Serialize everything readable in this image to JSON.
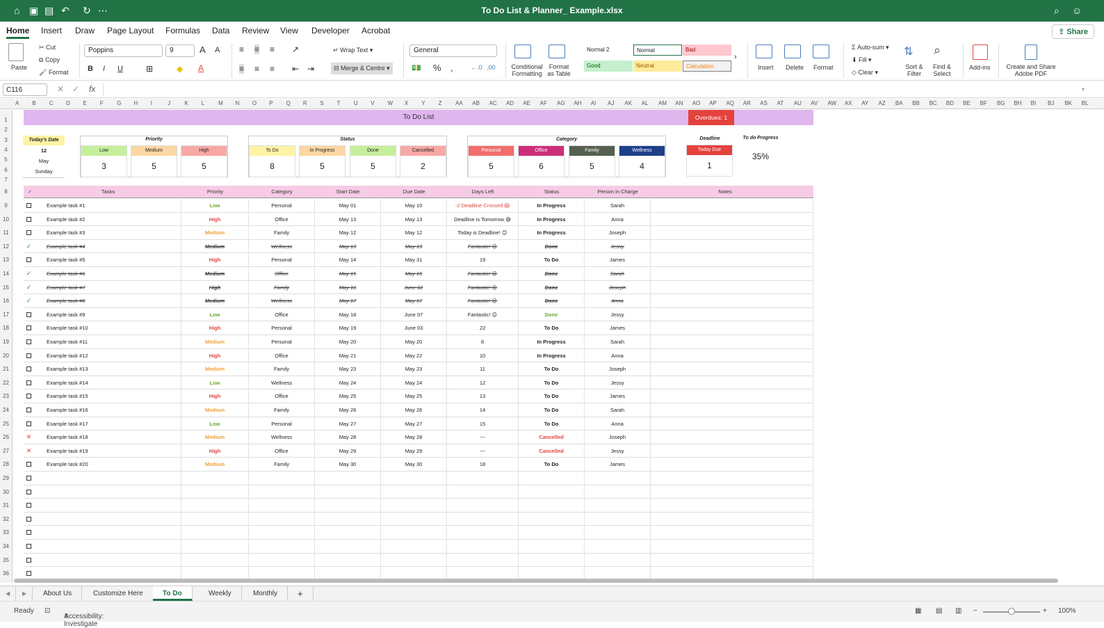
{
  "titlebar": {
    "title": "To Do List & Planner_ Example.xlsx"
  },
  "menu": {
    "tabs": [
      "Home",
      "Insert",
      "Draw",
      "Page Layout",
      "Formulas",
      "Data",
      "Review",
      "View",
      "Developer",
      "Acrobat"
    ],
    "share": "Share"
  },
  "ribbon": {
    "paste": "Paste",
    "cut": "Cut",
    "copy": "Copy",
    "format": "Format",
    "font": "Poppins",
    "font_size": "9",
    "wrap_text": "Wrap Text",
    "merge": "Merge & Centre",
    "number_format": "General",
    "conditional": "Conditional Formatting",
    "format_table": "Format as Table",
    "styles": {
      "normal2": "Normal 2",
      "normal": "Normal",
      "bad": "Bad",
      "good": "Good",
      "neutral": "Neutral",
      "calculation": "Calculation"
    },
    "insert": "Insert",
    "delete": "Delete",
    "format_cells": "Format",
    "autosum": "Auto-sum",
    "fill": "Fill",
    "clear": "Clear",
    "sort": "Sort & Filter",
    "find": "Find & Select",
    "addins": "Add-ins",
    "adobe": "Create and Share Adobe PDF"
  },
  "formula": {
    "namebox": "C116",
    "fx": "fx"
  },
  "columns": [
    "A",
    "B",
    "C",
    "D",
    "E",
    "F",
    "G",
    "H",
    "I",
    "J",
    "K",
    "L",
    "M",
    "N",
    "O",
    "P",
    "Q",
    "R",
    "S",
    "T",
    "U",
    "V",
    "W",
    "X",
    "Y",
    "Z",
    "AA",
    "AB",
    "AC",
    "AD",
    "AE",
    "AF",
    "AG",
    "AH",
    "AI",
    "AJ",
    "AK",
    "AL",
    "AM",
    "AN",
    "AO",
    "AP",
    "AQ",
    "AR",
    "AS",
    "AT",
    "AU",
    "AV",
    "AW",
    "AX",
    "AY",
    "AZ",
    "BA",
    "BB",
    "BC",
    "BD",
    "BE",
    "BF",
    "BG",
    "BH",
    "BI",
    "BJ",
    "BK",
    "BL"
  ],
  "sheet": {
    "title": "To Do List",
    "overdue": "Overdues: 1",
    "today": {
      "label": "Today's Date",
      "day": "12",
      "month": "May",
      "weekday": "Sunday"
    },
    "priority": {
      "title": "Priority",
      "items": [
        {
          "label": "Low",
          "value": "3"
        },
        {
          "label": "Medium",
          "value": "5"
        },
        {
          "label": "High",
          "value": "5"
        }
      ]
    },
    "status": {
      "title": "Status",
      "items": [
        {
          "label": "To Do",
          "value": "8"
        },
        {
          "label": "In Progress",
          "value": "5"
        },
        {
          "label": "Done",
          "value": "5"
        },
        {
          "label": "Cancelled",
          "value": "2"
        }
      ]
    },
    "category": {
      "title": "Category",
      "items": [
        {
          "label": "Personal",
          "value": "5"
        },
        {
          "label": "Office",
          "value": "6"
        },
        {
          "label": "Family",
          "value": "5"
        },
        {
          "label": "Wellness",
          "value": "4"
        }
      ]
    },
    "deadline": {
      "title": "Deadline",
      "label": "Today Due",
      "value": "1"
    },
    "progress": {
      "label": "To do Progress",
      "value": "35%"
    },
    "headers": {
      "check": "✓",
      "tasks": "Tasks",
      "priority": "Priority",
      "category": "Category",
      "start": "Start Date",
      "due": "Due Date",
      "days": "Days Left",
      "status": "Status",
      "person": "Person in Charge",
      "notes": "Notes"
    },
    "rows": [
      {
        "mark": "box",
        "task": "Example task #1",
        "priority": "Low",
        "category": "Personal",
        "start": "May 01",
        "due": "May 10",
        "days": "-2 Deadline Crossed 😱",
        "status": "In Progress",
        "person": "Sarah"
      },
      {
        "mark": "box",
        "task": "Example task #2",
        "priority": "High",
        "category": "Office",
        "start": "May 13",
        "due": "May 13",
        "days": "Deadline is Tomorrow 😅",
        "status": "In Progress",
        "person": "Anna"
      },
      {
        "mark": "box",
        "task": "Example task #3",
        "priority": "Medium",
        "category": "Family",
        "start": "May 12",
        "due": "May 12",
        "days": "Today is Deadline! 😊",
        "status": "In Progress",
        "person": "Joseph"
      },
      {
        "mark": "check",
        "task": "Example task #4",
        "priority": "Medium",
        "category": "Wellness",
        "start": "May 13",
        "due": "May 13",
        "days": "Fantastic! 😉",
        "status": "Done",
        "person": "Jessy"
      },
      {
        "mark": "box",
        "task": "Example task #5",
        "priority": "High",
        "category": "Personal",
        "start": "May 14",
        "due": "May 31",
        "days": "19",
        "status": "To Do",
        "person": "James"
      },
      {
        "mark": "check",
        "task": "Example task #6",
        "priority": "Medium",
        "category": "Office",
        "start": "May 15",
        "due": "May 15",
        "days": "Fantastic! 😉",
        "status": "Done",
        "person": "Sarah"
      },
      {
        "mark": "check",
        "task": "Example task #7",
        "priority": "High",
        "category": "Family",
        "start": "May 16",
        "due": "June 02",
        "days": "Fantastic! 😉",
        "status": "Done",
        "person": "Joseph"
      },
      {
        "mark": "check",
        "task": "Example task #8",
        "priority": "Medium",
        "category": "Wellness",
        "start": "May 17",
        "due": "May 17",
        "days": "Fantastic! 😉",
        "status": "Done",
        "person": "Anna"
      },
      {
        "mark": "box",
        "task": "Example task #9",
        "priority": "Low",
        "category": "Office",
        "start": "May 18",
        "due": "June 07",
        "days": "Fantastic! 😉",
        "status": "Done",
        "person": "Jessy"
      },
      {
        "mark": "box",
        "task": "Example task #10",
        "priority": "High",
        "category": "Personal",
        "start": "May 19",
        "due": "June 03",
        "days": "22",
        "status": "To Do",
        "person": "James"
      },
      {
        "mark": "box",
        "task": "Example task #11",
        "priority": "Medium",
        "category": "Personal",
        "start": "May 20",
        "due": "May 20",
        "days": "8",
        "status": "In Progress",
        "person": "Sarah"
      },
      {
        "mark": "box",
        "task": "Example task #12",
        "priority": "High",
        "category": "Office",
        "start": "May 21",
        "due": "May 22",
        "days": "10",
        "status": "In Progress",
        "person": "Anna"
      },
      {
        "mark": "box",
        "task": "Example task #13",
        "priority": "Medium",
        "category": "Family",
        "start": "May 23",
        "due": "May 23",
        "days": "11",
        "status": "To Do",
        "person": "Joseph"
      },
      {
        "mark": "box",
        "task": "Example task #14",
        "priority": "Low",
        "category": "Wellness",
        "start": "May 24",
        "due": "May 24",
        "days": "12",
        "status": "To Do",
        "person": "Jessy"
      },
      {
        "mark": "box",
        "task": "Example task #15",
        "priority": "High",
        "category": "Office",
        "start": "May 25",
        "due": "May 25",
        "days": "13",
        "status": "To Do",
        "person": "James"
      },
      {
        "mark": "box",
        "task": "Example task #16",
        "priority": "Medium",
        "category": "Family",
        "start": "May 26",
        "due": "May 26",
        "days": "14",
        "status": "To Do",
        "person": "Sarah"
      },
      {
        "mark": "box",
        "task": "Example task #17",
        "priority": "Low",
        "category": "Personal",
        "start": "May 27",
        "due": "May 27",
        "days": "15",
        "status": "To Do",
        "person": "Anna"
      },
      {
        "mark": "cross",
        "task": "Example task #18",
        "priority": "Medium",
        "category": "Wellness",
        "start": "May 28",
        "due": "May 28",
        "days": "---",
        "status": "Cancelled",
        "person": "Joseph"
      },
      {
        "mark": "cross",
        "task": "Example task #19",
        "priority": "High",
        "category": "Office",
        "start": "May 29",
        "due": "May 29",
        "days": "---",
        "status": "Cancelled",
        "person": "Jessy"
      },
      {
        "mark": "box",
        "task": "Example task #20",
        "priority": "Medium",
        "category": "Family",
        "start": "May 30",
        "due": "May 30",
        "days": "18",
        "status": "To Do",
        "person": "James"
      },
      {
        "mark": "box",
        "task": "",
        "priority": "",
        "category": "",
        "start": "",
        "due": "",
        "days": "",
        "status": "",
        "person": ""
      },
      {
        "mark": "box",
        "task": "",
        "priority": "",
        "category": "",
        "start": "",
        "due": "",
        "days": "",
        "status": "",
        "person": ""
      },
      {
        "mark": "box",
        "task": "",
        "priority": "",
        "category": "",
        "start": "",
        "due": "",
        "days": "",
        "status": "",
        "person": ""
      },
      {
        "mark": "box",
        "task": "",
        "priority": "",
        "category": "",
        "start": "",
        "due": "",
        "days": "",
        "status": "",
        "person": ""
      },
      {
        "mark": "box",
        "task": "",
        "priority": "",
        "category": "",
        "start": "",
        "due": "",
        "days": "",
        "status": "",
        "person": ""
      },
      {
        "mark": "box",
        "task": "",
        "priority": "",
        "category": "",
        "start": "",
        "due": "",
        "days": "",
        "status": "",
        "person": ""
      },
      {
        "mark": "box",
        "task": "",
        "priority": "",
        "category": "",
        "start": "",
        "due": "",
        "days": "",
        "status": "",
        "person": ""
      },
      {
        "mark": "box",
        "task": "",
        "priority": "",
        "category": "",
        "start": "",
        "due": "",
        "days": "",
        "status": "",
        "person": ""
      }
    ]
  },
  "sheets": {
    "tabs": [
      "About Us",
      "Customize Here",
      "To Do",
      "Weekly",
      "Monthly"
    ],
    "active": "To Do",
    "add": "+"
  },
  "status": {
    "ready": "Ready",
    "accessibility": "Accessibility: Investigate",
    "zoom": "100%"
  },
  "colors": {
    "excel_green": "#217346",
    "banner": "#dfb6ee",
    "overdue": "#e4423d",
    "low": "#c6ef9b",
    "medium": "#fcd7a4",
    "high": "#f8a8a4",
    "todo": "#fff3a6",
    "inprogress": "#fcd7a4",
    "done": "#c6ef9b",
    "cancelled": "#f8a8a4",
    "personal": "#f26d6d",
    "office": "#cc2f7a",
    "family": "#55604f",
    "wellness": "#1e3f8a"
  }
}
